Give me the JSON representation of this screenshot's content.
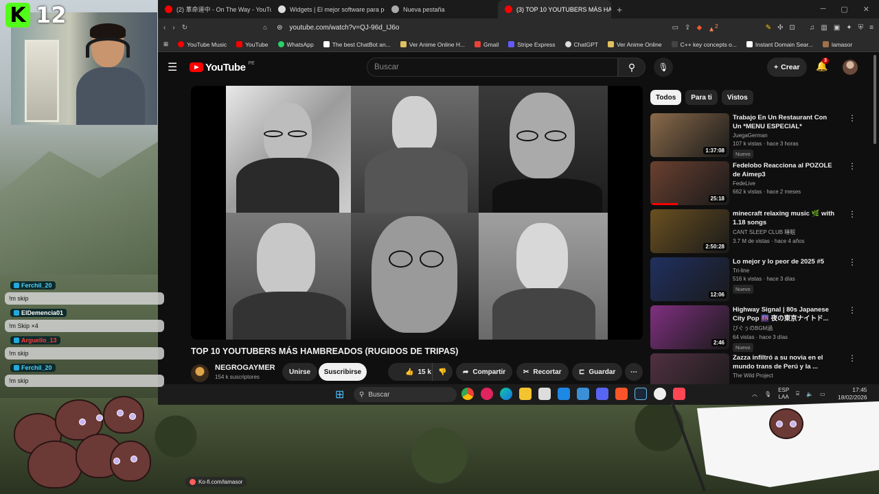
{
  "browser": {
    "tabs": [
      {
        "label": "(2) 革命道中 - On The Way - YouTube",
        "color": "#ff0000",
        "active": false
      },
      {
        "label": "Widgets | El mejor software para pot",
        "color": "#dddddd",
        "active": false
      },
      {
        "label": "Nueva pestaña",
        "color": "#aaaaaa",
        "active": false
      },
      {
        "label": "(3) TOP 10 YOUTUBERS MÁS HA",
        "color": "#ff0000",
        "active": true
      }
    ],
    "url": "youtube.com/watch?v=QJ-96d_IJ6o",
    "ext_badge": "2",
    "bookmarks": [
      {
        "label": "YouTube Music",
        "color": "#ff0000"
      },
      {
        "label": "YouTube",
        "color": "#ff0000"
      },
      {
        "label": "WhatsApp",
        "color": "#25d366"
      },
      {
        "label": "The best ChatBot an...",
        "color": "#ffffff"
      },
      {
        "label": "Ver Anime Online H...",
        "color": "#e0c060"
      },
      {
        "label": "Gmail",
        "color": "#ea4335"
      },
      {
        "label": "Stripe Express",
        "color": "#635bff"
      },
      {
        "label": "ChatGPT",
        "color": "#dddddd"
      },
      {
        "label": "Ver Anime Online",
        "color": "#e0c060"
      },
      {
        "label": "C++ key concepts o...",
        "color": "#444444"
      },
      {
        "label": "Instant Domain Sear...",
        "color": "#ffffff"
      },
      {
        "label": "lamasor",
        "color": "#a0704a"
      }
    ]
  },
  "youtube": {
    "logo": "YouTube",
    "region": "PE",
    "search_placeholder": "Buscar",
    "create_label": "Crear",
    "notif_count": "3",
    "video": {
      "title": "TOP 10 YOUTUBERS MÁS HAMBREADOS (RUGIDOS DE TRIPAS)",
      "channel": "NEGROGAYMER",
      "subs": "154 k suscriptores",
      "join": "Unirse",
      "subscribe": "Suscribirse",
      "likes": "15 k",
      "share": "Compartir",
      "clip": "Recortar",
      "save": "Guardar"
    },
    "chips": [
      "Todos",
      "Para ti",
      "Vistos"
    ],
    "recs": [
      {
        "title": "Trabajo En Un Restaurant Con Un *MENU ESPECIAL*",
        "channel": "JuegaGerman",
        "meta": "107 k vistas · hace 3 horas",
        "badge": "Nuevo",
        "duration": "1:37:08",
        "thumb": "#8a6a4a",
        "progress": 0
      },
      {
        "title": "Fedelobo Reacciona al POZOLE de Aimep3",
        "channel": "FedeLive",
        "meta": "662 k vistas · hace 2 meses",
        "badge": "",
        "duration": "25:18",
        "thumb": "#6a4030",
        "progress": 0.35
      },
      {
        "title": "minecraft relaxing music 🌿 with 1.18 songs",
        "channel": "CANT SLEEP CLUB 睡眠",
        "meta": "3.7 M de vistas · hace 4 años",
        "badge": "",
        "duration": "2:50:28",
        "thumb": "#6a5020",
        "progress": 0
      },
      {
        "title": "Lo mejor y lo peor de 2025 #5",
        "channel": "Tri-line",
        "meta": "516 k vistas · hace 3 días",
        "badge": "Nuevo",
        "duration": "12:06",
        "thumb": "#203060",
        "progress": 0
      },
      {
        "title": "Highway Signal | 80s Japanese City Pop 🌆 夜の東京ナイトド...",
        "channel": "びぐぅのBGM過",
        "meta": "64 vistas · hace 3 días",
        "badge": "Nuevo",
        "duration": "2:46",
        "thumb": "#803080",
        "progress": 0
      },
      {
        "title": "Zazza infiltró a su novia en el mundo trans de Perú y la ...",
        "channel": "The Wild Project",
        "meta": "",
        "badge": "",
        "duration": "",
        "thumb": "#503040",
        "progress": 0
      }
    ]
  },
  "taskbar": {
    "search": "Buscar",
    "lang": "ESP",
    "lang2": "LAA",
    "time": "17:45",
    "date": "18/02/2026"
  },
  "stream": {
    "kick_count": "12",
    "chat": [
      {
        "user": "Ferchil_20",
        "user_color": "#4fd1ff",
        "text": "!m skip"
      },
      {
        "user": "ElDemencia01",
        "user_color": "#ffffff",
        "text": "!m Skip ×4"
      },
      {
        "user": "Arguello_13",
        "user_color": "#ff3b3b",
        "text": "!m skip"
      },
      {
        "user": "Ferchil_20",
        "user_color": "#4fd1ff",
        "text": "!m skip"
      }
    ],
    "kofi": "Ko-fi.com/lamasor"
  }
}
